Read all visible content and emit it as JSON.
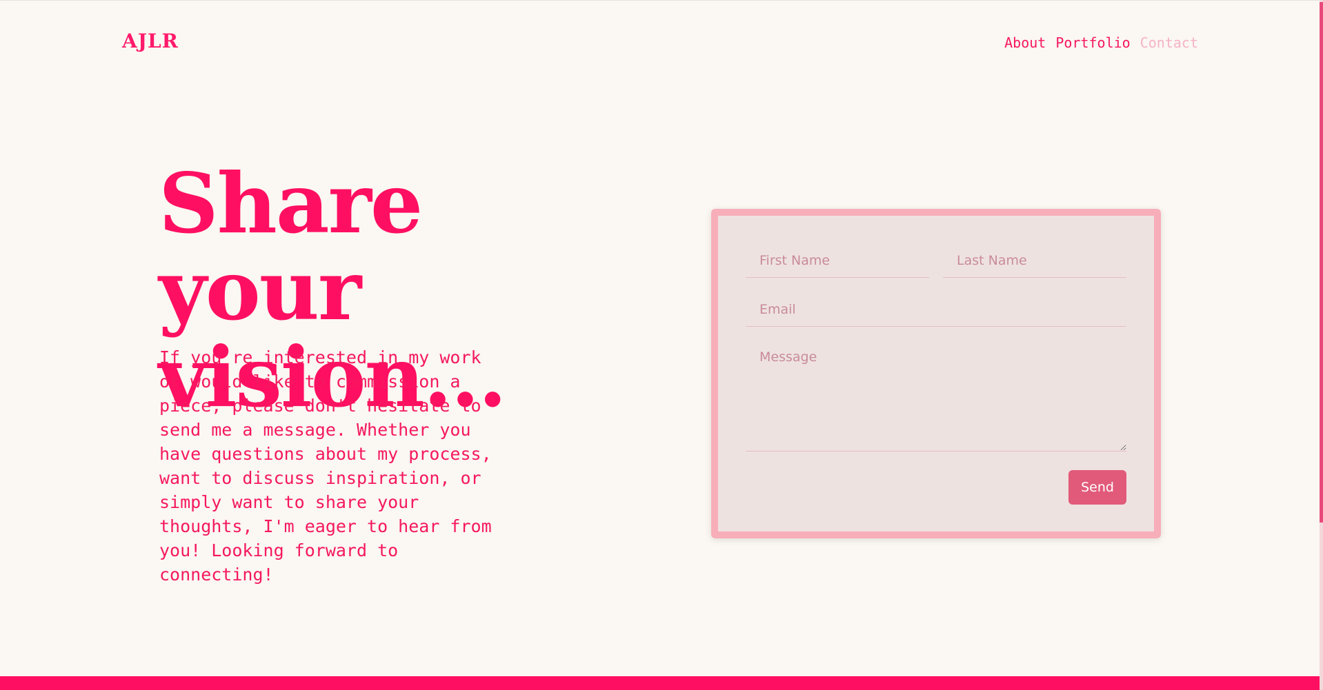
{
  "header": {
    "logo": "AJLR",
    "nav": [
      {
        "label": "About",
        "active": true
      },
      {
        "label": "Portfolio",
        "active": true
      },
      {
        "label": "Contact",
        "active": false
      }
    ]
  },
  "hero": {
    "title": "Share your vision...",
    "text": "If you're interested in my work or would like to commission a piece, please don't hesitate to send me a message. Whether you have questions about my process, want to discuss inspiration, or simply want to share your thoughts, I'm eager to hear from you! Looking forward to connecting!"
  },
  "form": {
    "first_name": {
      "placeholder": "First Name",
      "value": ""
    },
    "last_name": {
      "placeholder": "Last Name",
      "value": ""
    },
    "email": {
      "placeholder": "Email",
      "value": ""
    },
    "message": {
      "placeholder": "Message",
      "value": ""
    },
    "send_label": "Send"
  },
  "colors": {
    "background": "#fbf7f2",
    "accent": "#ff0f62",
    "nav_inactive": "#f5b3c6",
    "form_border": "#f7aeb9",
    "form_background": "#eee2e0",
    "button": "#e15a7a"
  }
}
